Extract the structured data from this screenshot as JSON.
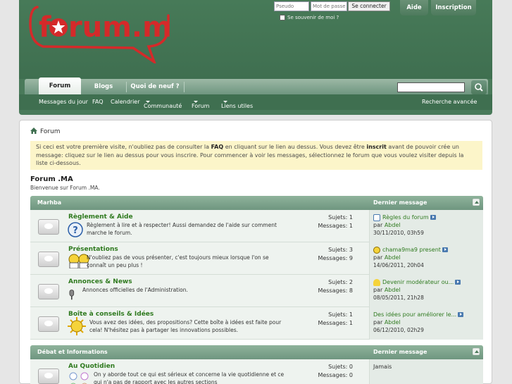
{
  "header": {
    "logo_text": "forum.ma",
    "login": {
      "username_placeholder": "Pseudo",
      "password_placeholder": "Mot de passe",
      "submit_label": "Se connecter",
      "remember_label": "Se souvenir de moi ?"
    },
    "buttons": {
      "help": "Aide",
      "register": "Inscription"
    }
  },
  "navbar": {
    "tabs": [
      {
        "label": "Forum"
      },
      {
        "label": "Blogs"
      },
      {
        "label": "Quoi de neuf ?"
      }
    ],
    "sub_links": [
      {
        "label": "Messages du jour"
      },
      {
        "label": "FAQ"
      },
      {
        "label": "Calendrier"
      },
      {
        "label": "Communauté"
      },
      {
        "label": "Forum"
      },
      {
        "label": "Liens utiles"
      }
    ],
    "advanced_search": "Recherche avancée"
  },
  "breadcrumb": {
    "label": "Forum"
  },
  "notice": {
    "part1": "Si ceci est votre première visite, n'oubliez pas de consulter la ",
    "faq": "FAQ",
    "part2": " en cliquant sur le lien au dessus. Vous devez être ",
    "register": "inscrit",
    "part3": " avant de pouvoir crée un message: cliquez sur le lien au dessus pour vous inscrire. Pour commencer à voir les messages, sélectionnez le forum que vous voulez visiter depuis la liste ci-dessous."
  },
  "forum": {
    "title": "Forum .MA",
    "subtitle": "Bienvenue sur Forum .MA."
  },
  "categories": [
    {
      "name": "Marhba",
      "last_header": "Dernier message",
      "forums": [
        {
          "name": "Règlement & Aide",
          "desc": "Règlement à lire et à respecter! Aussi demandez de l'aide sur comment marche le forum.",
          "subjects": "Sujets: 1",
          "messages": "Messages: 1",
          "last_title": "Règles du forum",
          "last_by": "par ",
          "last_user": "Abdel",
          "last_date": "30/11/2010, 03h59"
        },
        {
          "name": "Présentations",
          "desc": "N'oubliez pas de vous présenter, c'est toujours mieux lorsque l'on se connaît un peu plus !",
          "subjects": "Sujets: 3",
          "messages": "Messages: 9",
          "last_title": "chama9ma9 present",
          "last_by": "par ",
          "last_user": "Abdel",
          "last_date": "14/06/2011, 20h04"
        },
        {
          "name": "Annonces & News",
          "desc": "Annonces officielles de l'Administration.",
          "subjects": "Sujets: 2",
          "messages": "Messages: 8",
          "last_title": "Devenir modérateur ou...",
          "last_by": "par ",
          "last_user": "Abdel",
          "last_date": "08/05/2011, 21h28"
        },
        {
          "name": "Boîte à conseils & Idées",
          "desc": "Vous avez des idées, des propositions? Cette boîte à idées est faite pour cela! N'hésitez pas à partager les innovations possibles.",
          "subjects": "Sujets: 1",
          "messages": "Messages: 1",
          "last_title": "Des idées pour améliorer le...",
          "last_by": "par ",
          "last_user": "Abdel",
          "last_date": "06/12/2010, 02h29"
        }
      ]
    },
    {
      "name": "Débat et Informations",
      "last_header": "Dernier message",
      "forums": [
        {
          "name": "Au Quotidien",
          "desc": "On y aborde tout ce qui est sérieux et concerne la vie quotidienne et ce qui n'a pas de rapport avec les autres sections",
          "subjects": "Sujets: 0",
          "messages": "Messages: 0",
          "last_title": "Jamais"
        }
      ]
    }
  ],
  "colors": {
    "header": "#3f6f50",
    "accent_green": "#2f7a1f",
    "notice_bg": "#fcf5c9",
    "logo_red": "#d42a2a"
  }
}
